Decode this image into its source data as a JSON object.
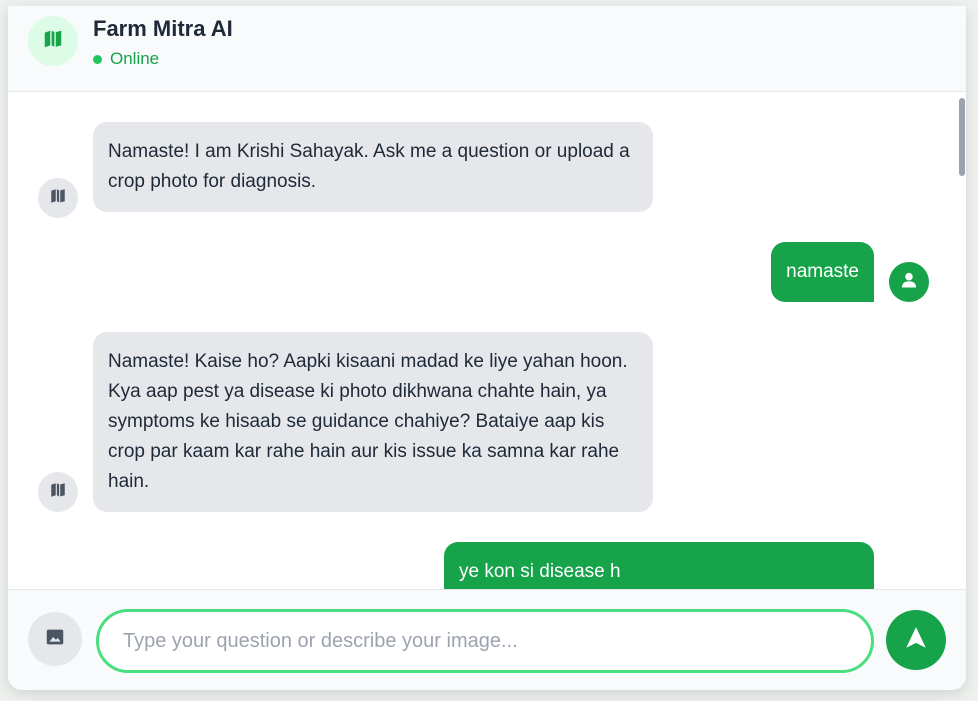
{
  "header": {
    "title": "Farm Mitra AI",
    "status": "Online",
    "logo_icon": "map-icon"
  },
  "messages": [
    {
      "sender": "bot",
      "text": "Namaste! I am Krishi Sahayak. Ask me a question or upload a crop photo for diagnosis."
    },
    {
      "sender": "user",
      "text": "namaste"
    },
    {
      "sender": "bot",
      "text": "Namaste! Kaise ho? Aapki kisaani madad ke liye yahan hoon. Kya aap pest ya disease ki photo dikhwana chahte hain, ya symptoms ke hisaab se guidance chahiye? Bataiye aap kis crop par kaam kar rahe hain aur kis issue ka samna kar rahe hain."
    },
    {
      "sender": "user",
      "text": "ye kon si disease h"
    }
  ],
  "composer": {
    "placeholder": "Type your question or describe your image...",
    "value": "",
    "upload_icon": "image-icon",
    "send_icon": "send-arrow-icon"
  },
  "colors": {
    "accent": "#16a34a",
    "bot_bubble": "#e5e7eb",
    "online": "#22c55e",
    "input_border": "#4ade80"
  }
}
